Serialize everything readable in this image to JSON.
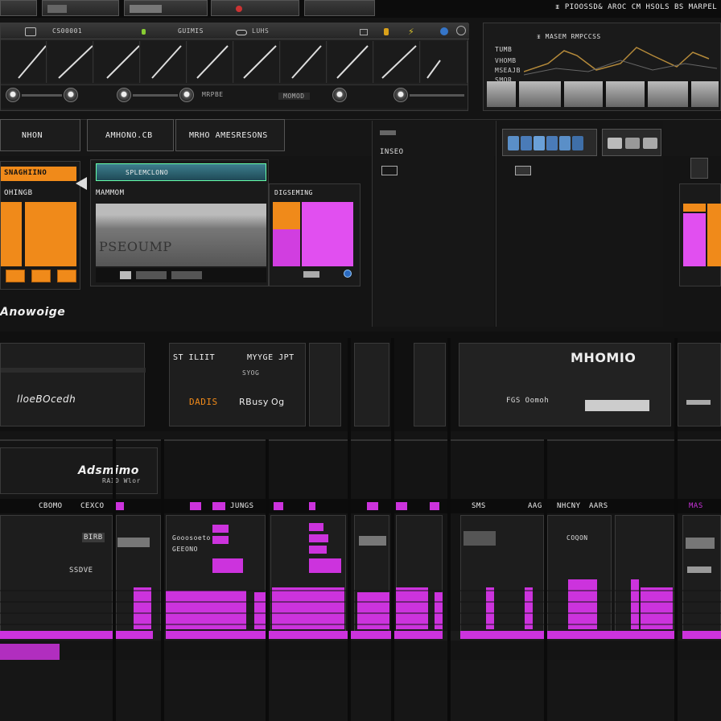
{
  "window": {
    "tabs": [
      "",
      "",
      "",
      "",
      ""
    ],
    "top_right_text": "ᵻ PIOOSSD& AROC  CM HSOLS  BS  MARPEL"
  },
  "transport": {
    "label": "CS00001",
    "menu_label": "GUIMIS",
    "small_label": "LUHS",
    "right_label": "MRPBE",
    "readout_label": "MOMOD"
  },
  "scope": {
    "title": "ᵻ  MASEM  RMPCCSS",
    "header_left": "TUMB",
    "line1": "VHOMB",
    "line2": "MSEAJB",
    "line3": "SMOR"
  },
  "nav": {
    "tab_1": "NHON",
    "tab_2": "AMHONO.CB",
    "tab_3": "MRHO AMESRESONS"
  },
  "left_panel": {
    "accent_header": "SNAGHIINO",
    "sub_header": "OHINGB",
    "footer_label": "Anowoige"
  },
  "preview": {
    "header": "SPLEMCLONO",
    "title": "MAMMOM",
    "screen_text": "PSEOUMP"
  },
  "magenta_panel": {
    "header": "DIGSEMING"
  },
  "center": {
    "label": "INSEO"
  },
  "tracks": {
    "block_1_label": "lloeBOcedh",
    "block_2_top_a": "ST ILIIT",
    "block_2_top_b": "MYYGE JPT",
    "block_2_small": "SYOG",
    "block_2_bottom_a": "DADIS",
    "block_2_bottom_b": "RBusy",
    "block_2_bottom_c": "Og",
    "block_3_title": "MHOMIO",
    "block_3_sub": "FGS Oomoh"
  },
  "mixer": {
    "logo": "Adsmimo",
    "sub": "RAID Wlor",
    "channel_names": [
      "CBOMO",
      "CEXCO",
      "JUNGS",
      "SMS",
      "AAG",
      "NHCNY",
      "AARS",
      "MAS"
    ],
    "strip_labels": [
      "BIRB",
      "Gooosoeto",
      "GEEONO",
      "SSDVE",
      "COQON"
    ]
  },
  "colors": {
    "accent_orange": "#f08a1a",
    "accent_magenta": "#cc33dd",
    "panel_bg": "#1c1c1c"
  }
}
